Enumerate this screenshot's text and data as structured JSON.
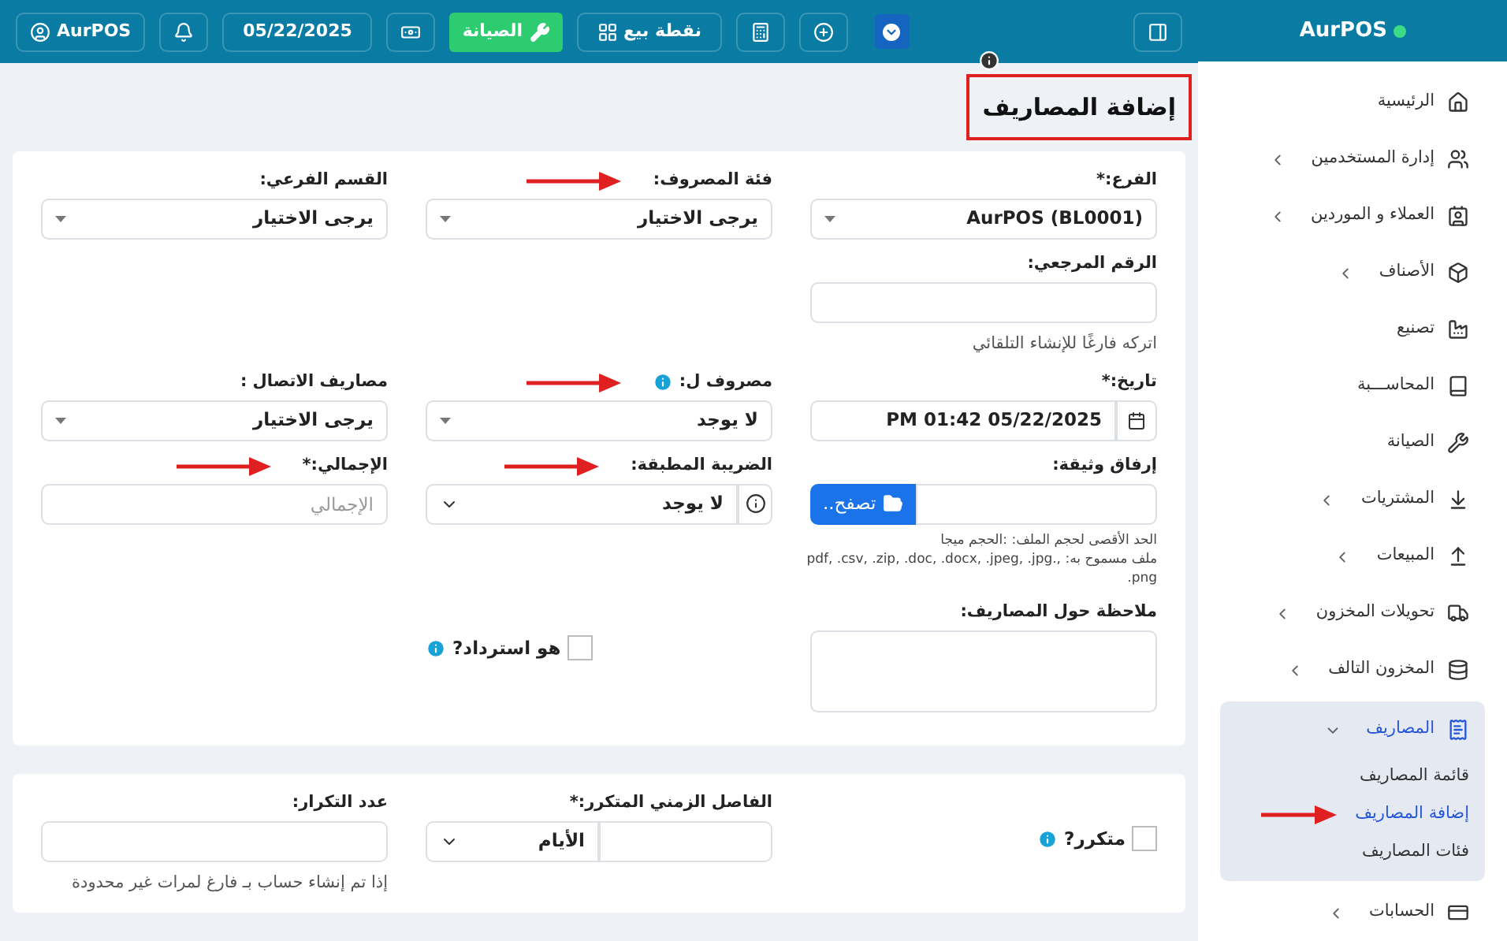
{
  "topbar": {
    "user": "AurPOS",
    "date": "05/22/2025",
    "maintenance_button": "الصيانة",
    "pos_button": "نقطة بيع"
  },
  "sidebar": {
    "brand": "AurPOS",
    "items": [
      {
        "label": "الرئيسية",
        "has_submenu": false
      },
      {
        "label": "إدارة المستخدمين",
        "has_submenu": true,
        "expanded": false
      },
      {
        "label": "العملاء و الموردين",
        "has_submenu": true,
        "expanded": false
      },
      {
        "label": "الأصناف",
        "has_submenu": true,
        "expanded": false
      },
      {
        "label": "تصنيع",
        "has_submenu": false
      },
      {
        "label": "المحاســـبة",
        "has_submenu": false
      },
      {
        "label": "الصيانة",
        "has_submenu": false
      },
      {
        "label": "المشتريات",
        "has_submenu": true,
        "expanded": false
      },
      {
        "label": "المبيعات",
        "has_submenu": true,
        "expanded": false
      },
      {
        "label": "تحويلات المخزون",
        "has_submenu": true,
        "expanded": false
      },
      {
        "label": "المخزون التالف",
        "has_submenu": true,
        "expanded": false
      },
      {
        "label": "المصاريف",
        "has_submenu": true,
        "expanded": true,
        "children": [
          {
            "label": "قائمة المصاريف",
            "selected": false
          },
          {
            "label": "إضافة المصاريف",
            "selected": true,
            "arrow": true
          },
          {
            "label": "فئات المصاريف",
            "selected": false
          }
        ]
      },
      {
        "label": "الحسابات",
        "has_submenu": true,
        "expanded": false
      }
    ]
  },
  "page": {
    "title": "إضافة المصاريف",
    "title_highlighted": true
  },
  "form": {
    "rows": [
      [
        {
          "kind": "select",
          "label": "الفرع:*",
          "value": "AurPOS (BL0001)"
        },
        {
          "kind": "select",
          "label": "فئة المصروف:",
          "value": "يرجى الاختيار",
          "arrow": true
        },
        {
          "kind": "select",
          "label": "القسم الفرعي:",
          "value": "يرجى الاختيار"
        }
      ],
      [
        {
          "kind": "input",
          "label": "الرقم المرجعي:",
          "hint": "اتركه فارغًا للإنشاء التلقائي"
        },
        null,
        null
      ],
      [
        {
          "kind": "date",
          "label": "تاريخ:*",
          "value": "PM 01:42 05/22/2025"
        },
        {
          "kind": "select",
          "label": "مصروف ل:",
          "value": "لا يوجد",
          "info": true,
          "arrow": true
        },
        {
          "kind": "select",
          "label": "مصاريف الاتصال :",
          "value": "يرجى الاختيار"
        }
      ],
      [
        {
          "kind": "file",
          "label": "إرفاق وثيقة:",
          "button": "تصفح..",
          "hints": [
            "الحد الأقصى لحجم الملف: :الحجم ميجا",
            "ملف مسموح به: ,.pdf, .csv, .zip, .doc, .docx, .jpeg, .jpg",
            "png."
          ]
        },
        {
          "kind": "select_info",
          "label": "الضريبة المطبقة:",
          "value": "لا يوجد",
          "arrow": true
        },
        {
          "kind": "input",
          "label": "الإجمالي:*",
          "placeholder": "الإجمالي",
          "arrow": true
        }
      ],
      [
        {
          "kind": "textarea",
          "label": "ملاحظة حول المصاريف:"
        },
        {
          "kind": "checkbox",
          "label": "هو استرداد?",
          "checked": false,
          "info": true
        },
        null
      ]
    ]
  },
  "recurring": {
    "rows": [
      [
        {
          "kind": "checkbox",
          "label": "متكرر?",
          "checked": false,
          "info": true
        },
        {
          "kind": "input_select",
          "label": "الفاصل الزمني المتكرر:*",
          "value": "الأيام"
        },
        {
          "kind": "input",
          "label": "عدد التكرار:",
          "hint": "إذا تم إنشاء حساب بـ فارغ لمرات غير محدودة"
        }
      ]
    ]
  }
}
